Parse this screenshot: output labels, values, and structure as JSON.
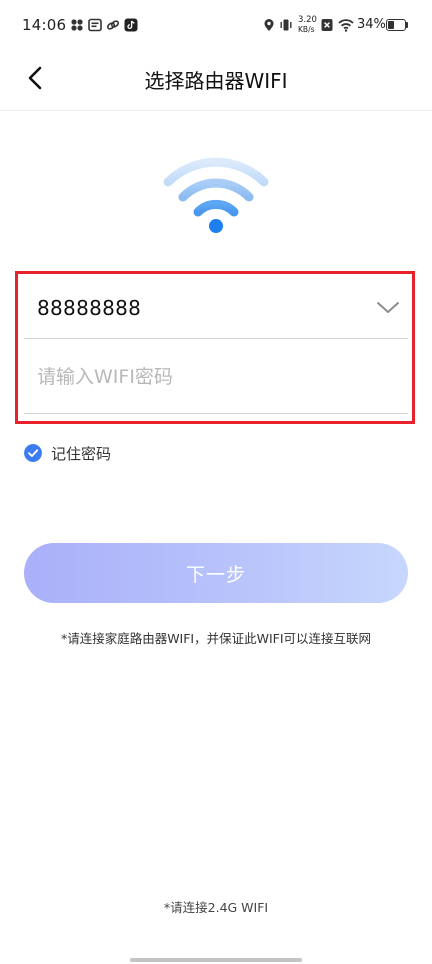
{
  "status_bar": {
    "time": "14:06",
    "net_speed_value": "3.20",
    "net_speed_unit": "KB/s",
    "battery": "34%",
    "icons": [
      "apps-icon",
      "message-icon",
      "link-icon",
      "tiktok-icon",
      "location-icon",
      "vibrate-icon",
      "no-sim-icon",
      "wifi-icon",
      "battery-icon"
    ]
  },
  "header": {
    "title": "选择路由器WIFI",
    "back_icon": "chevron-left-icon"
  },
  "form": {
    "ssid_value": "88888888",
    "password_placeholder": "请输入WIFI密码",
    "password_value": "",
    "remember_label": "记住密码",
    "remember_checked": true
  },
  "actions": {
    "next_label": "下一步"
  },
  "hints": {
    "connect_hint": "*请连接家庭路由器WIFI，并保证此WIFI可以连接互联网",
    "footer_hint": "*请连接2.4G WIFI"
  },
  "colors": {
    "accent": "#3d7cf0",
    "highlight_frame": "#e8212b",
    "button_gradient_start": "#aab0f9",
    "button_gradient_end": "#c7d7fc",
    "wifi_inner": "#1e7ff0",
    "wifi_outer": "#c5def8"
  }
}
